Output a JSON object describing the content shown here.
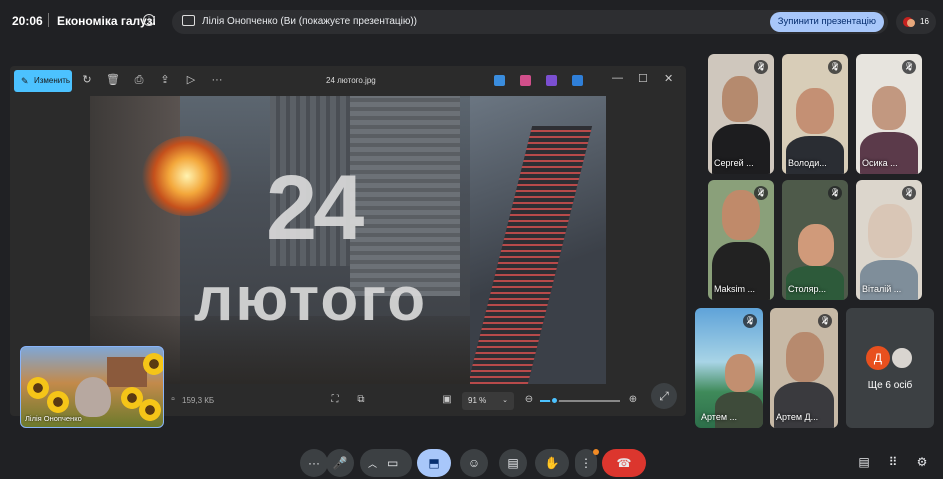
{
  "header": {
    "time": "20:06",
    "meeting_title": "Економіка галузі",
    "presenting_text": "Лілія Онопченко (Ви (покажуєте презентацію))",
    "stop_presenting": "Зупинити презентацію",
    "participant_count": "16"
  },
  "viewer": {
    "edit_label": "Изменить",
    "file_name": "24 лютого.jpg",
    "image_text_big": "24",
    "image_text_word": "лютого",
    "file_size": "159,3 КБ",
    "zoom": "91 %"
  },
  "self_view": {
    "name": "Лілія Онопченко"
  },
  "participants": [
    {
      "name": "Сергей ..."
    },
    {
      "name": "Володи..."
    },
    {
      "name": "Осика ..."
    },
    {
      "name": "Maksim ..."
    },
    {
      "name": "Столяр..."
    },
    {
      "name": "Віталій ..."
    },
    {
      "name": "Артем ..."
    },
    {
      "name": "Артем Д..."
    }
  ],
  "more": {
    "avatar_letter": "Д",
    "label": "Ще 6 осіб"
  },
  "colors": {
    "accent": "#a8c7fa",
    "end_call": "#dc362e",
    "edit_button": "#4cc2ff"
  },
  "icons": {
    "controls": [
      "more-options-icon",
      "mic-icon",
      "chevron-up-icon",
      "camera-icon",
      "present-icon",
      "emoji-icon",
      "captions-icon",
      "raise-hand-icon",
      "more-vert-icon",
      "end-call-icon"
    ],
    "side": [
      "chat-icon",
      "activities-icon",
      "host-controls-icon"
    ]
  }
}
